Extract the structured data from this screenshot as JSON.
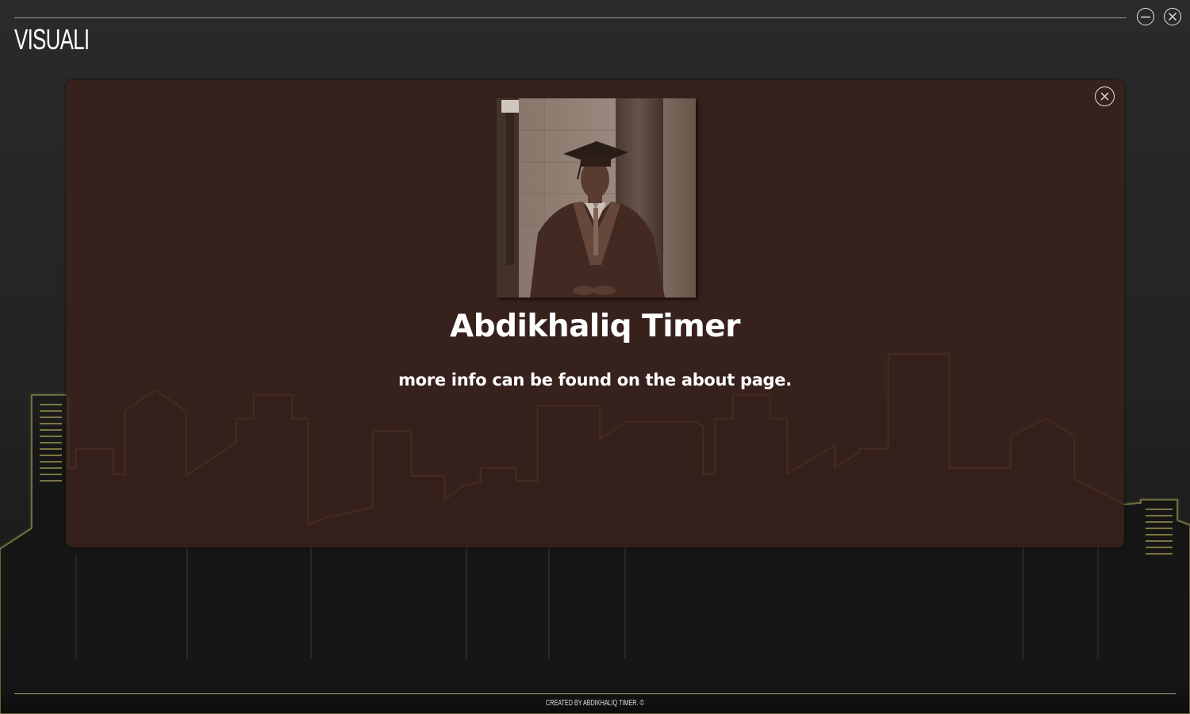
{
  "app": {
    "title": "VISUALI",
    "icons": {
      "minimize": "minimize-circle-icon",
      "close": "close-circle-icon"
    }
  },
  "modal": {
    "name": "Abdikhaliq Timer",
    "info": "more info can be found on the about page.",
    "photo_alt": "Portrait of a graduate in cap and gown",
    "close_icon": "close-circle-icon"
  },
  "footer": {
    "text": "Created by Abdikhaliq Timer. ©"
  },
  "colors": {
    "background": "#262626",
    "modal": "#3a211c",
    "skyline_outline": "#7c7a42",
    "text": "#ffffff"
  }
}
